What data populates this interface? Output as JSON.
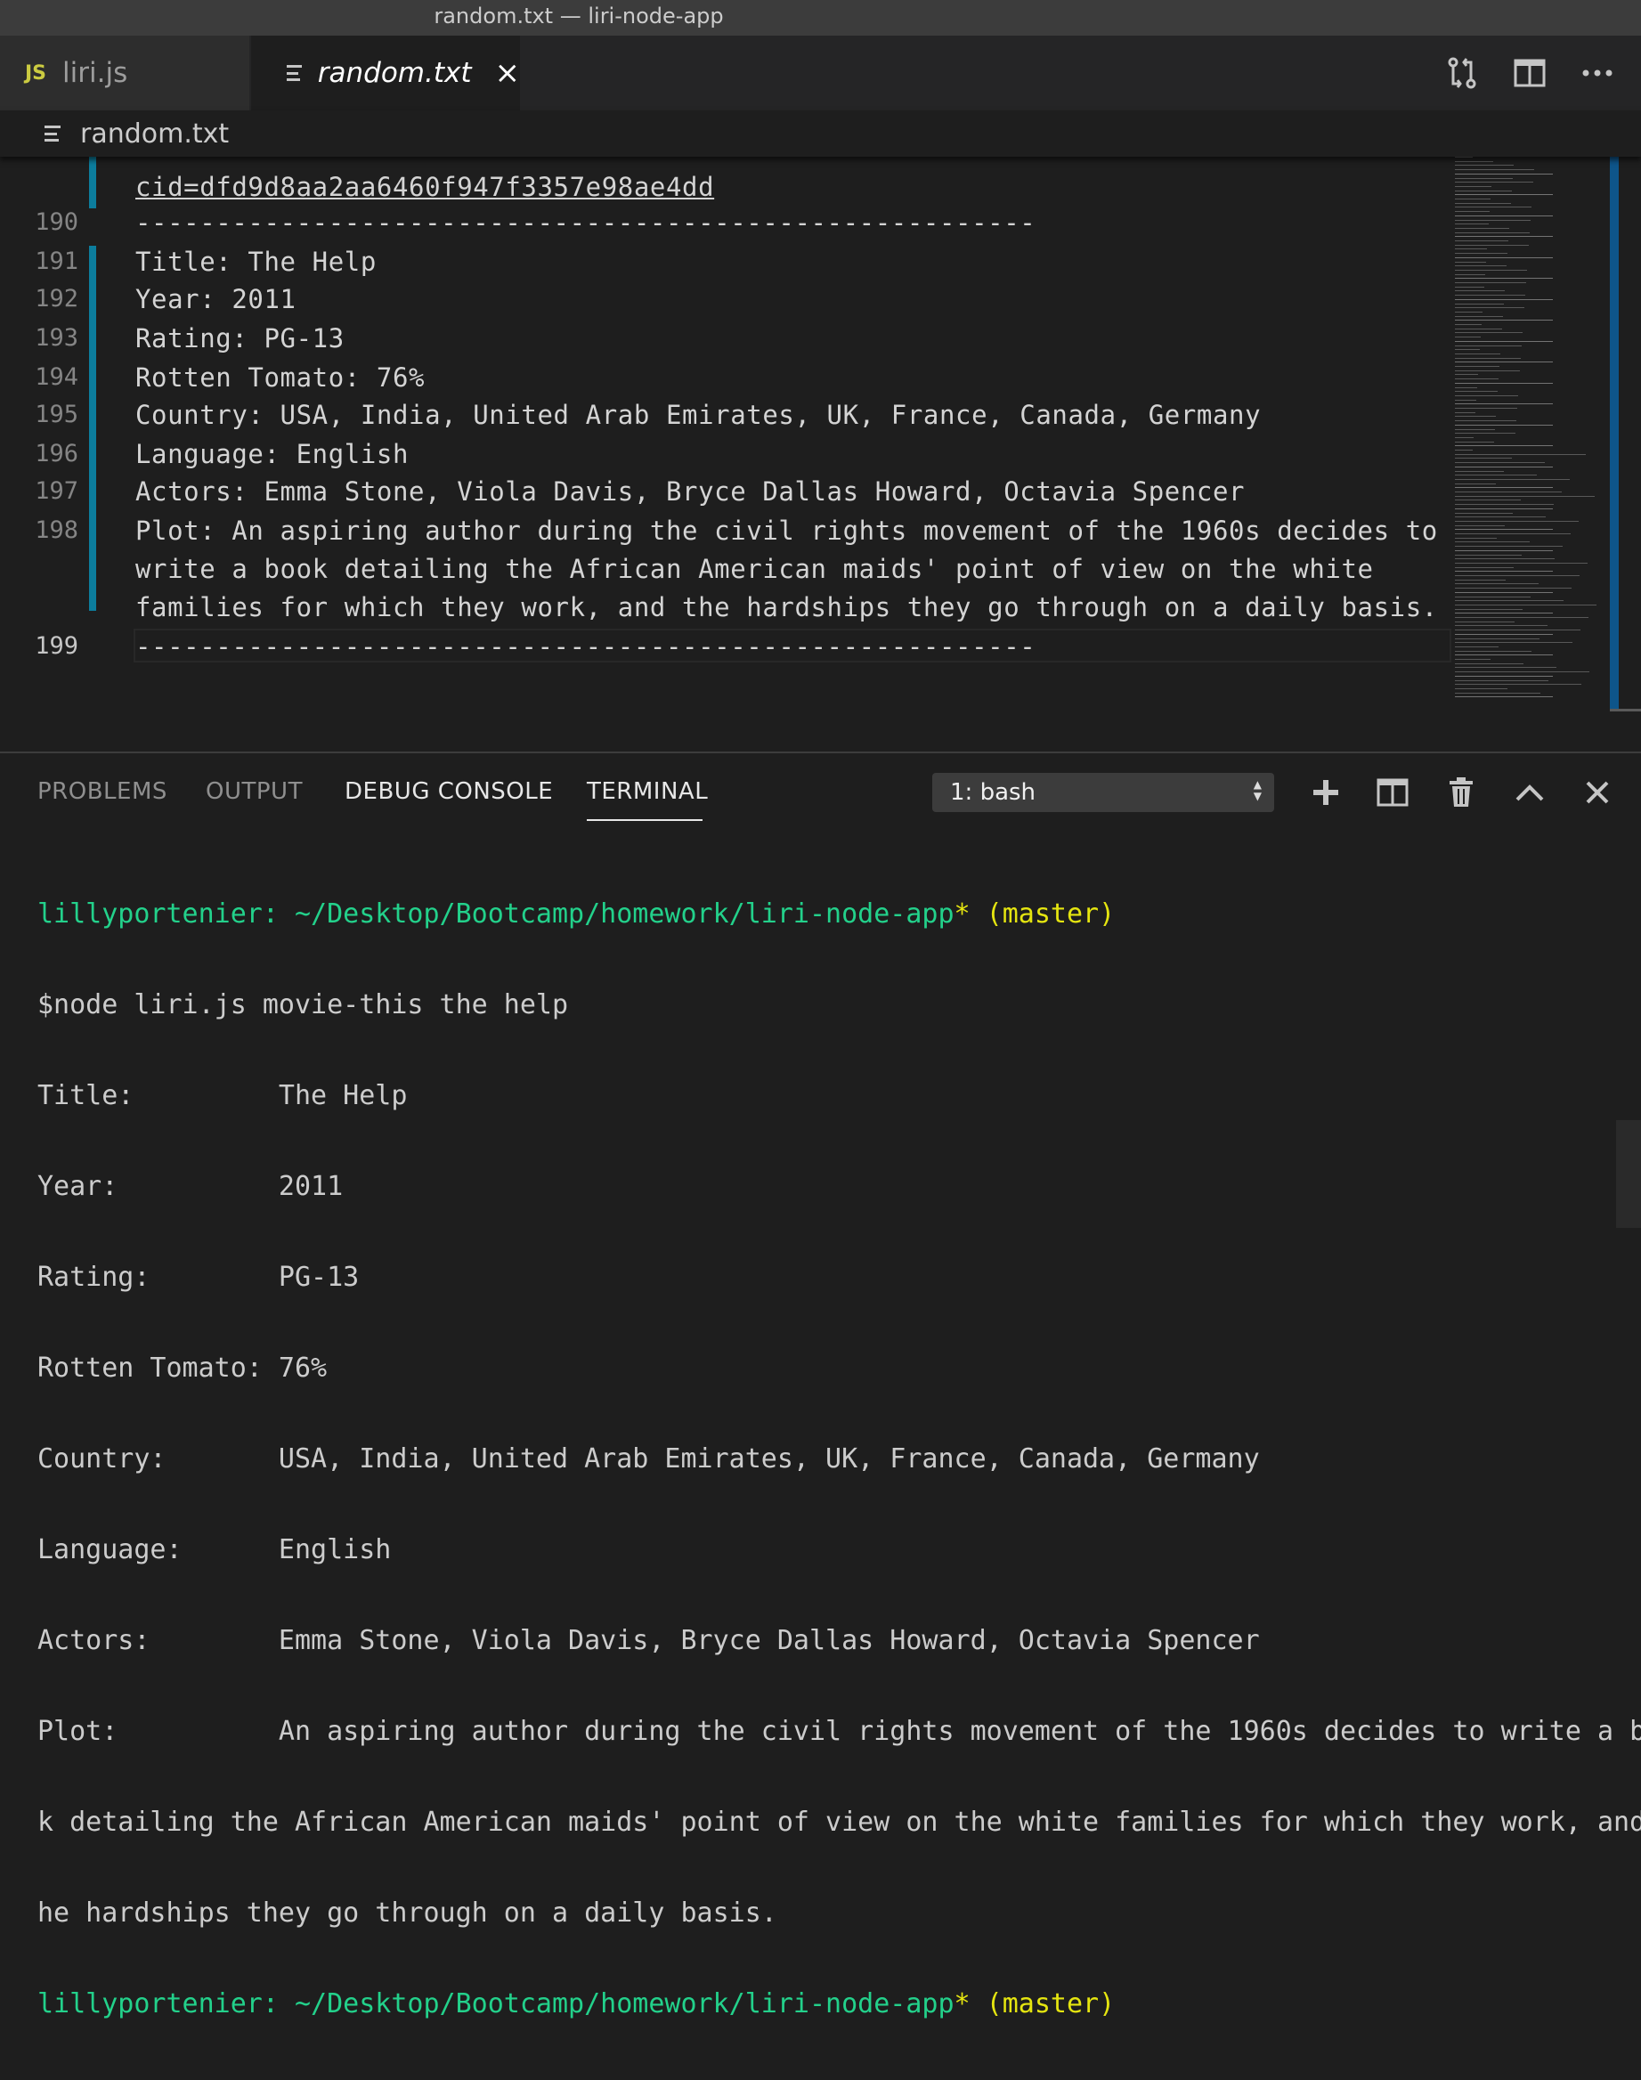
{
  "window": {
    "title": "random.txt — liri-node-app"
  },
  "tabs": [
    {
      "badge": "JS",
      "label": "liri.js"
    },
    {
      "label": "random.txt",
      "close": "×"
    }
  ],
  "breadcrumb": {
    "label": "random.txt"
  },
  "editor": {
    "link_line": "cid=dfd9d8aa2aa6460f947f3357e98ae4dd",
    "separator": "--------------------------------------------------------",
    "lines": [
      {
        "num": "190",
        "text": "--------------------------------------------------------"
      },
      {
        "num": "191",
        "text": "Title: The Help"
      },
      {
        "num": "192",
        "text": "Year: 2011"
      },
      {
        "num": "193",
        "text": "Rating: PG-13"
      },
      {
        "num": "194",
        "text": "Rotten Tomato: 76%"
      },
      {
        "num": "195",
        "text": "Country: USA, India, United Arab Emirates, UK, France, Canada, Germany"
      },
      {
        "num": "196",
        "text": "Language: English"
      },
      {
        "num": "197",
        "text": "Actors: Emma Stone, Viola Davis, Bryce Dallas Howard, Octavia Spencer"
      },
      {
        "num": "198",
        "text": "Plot: An aspiring author during the civil rights movement of the 1960s decides to"
      },
      {
        "num": "",
        "text": "write a book detailing the African American maids' point of view on the white"
      },
      {
        "num": "",
        "text": "families for which they work, and the hardships they go through on a daily basis."
      },
      {
        "num": "199",
        "text": "--------------------------------------------------------"
      }
    ]
  },
  "panel": {
    "tabs": [
      "PROBLEMS",
      "OUTPUT",
      "DEBUG CONSOLE",
      "TERMINAL"
    ],
    "active_tab": "TERMINAL",
    "terminal_select": "1: bash"
  },
  "terminal": {
    "prompt_user": "lillyportenier:",
    "prompt_path": " ~/Desktop/Bootcamp/homework/liri-node-app",
    "prompt_dirty": "*",
    "prompt_branch": " (master)",
    "command": "$node liri.js movie-this the help",
    "output": [
      "Title:         The Help",
      "Year:          2011",
      "Rating:        PG-13",
      "Rotten Tomato: 76%",
      "Country:       USA, India, United Arab Emirates, UK, France, Canada, Germany",
      "Language:      English",
      "Actors:        Emma Stone, Viola Davis, Bryce Dallas Howard, Octavia Spencer",
      "Plot:          An aspiring author during the civil rights movement of the 1960s decides to write a boo",
      "k detailing the African American maids' point of view on the white families for which they work, and t",
      "he hardships they go through on a daily basis."
    ]
  },
  "colors": {
    "accent": "#0c7d9d",
    "prompt_green": "#23d18b",
    "prompt_yellow": "#e5e510"
  }
}
